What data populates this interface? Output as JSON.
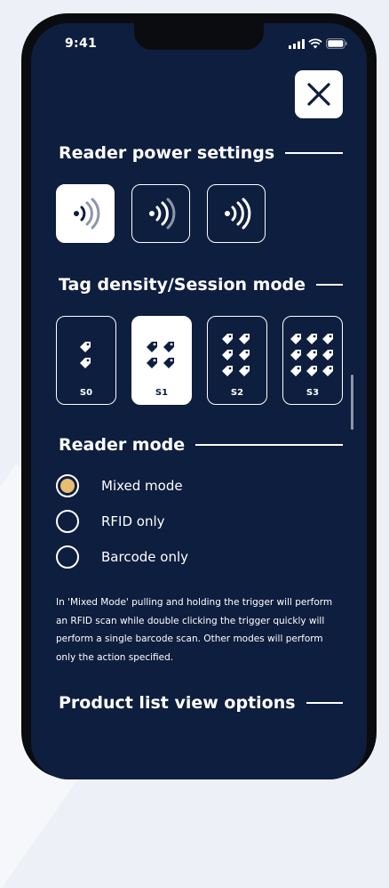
{
  "status_bar": {
    "time": "9:41"
  },
  "colors": {
    "background": "#0e1e3e",
    "accent": "#e9bd6f",
    "text": "#ffffff",
    "wave_muted": "#8d97ab"
  },
  "sections": {
    "power_title": "Reader power settings",
    "density_title": "Tag density/Session mode",
    "mode_title": "Reader mode",
    "list_title": "Product list view options"
  },
  "power_levels": [
    {
      "icon": "signal-strength-low-icon",
      "selected": true
    },
    {
      "icon": "signal-strength-medium-icon",
      "selected": false
    },
    {
      "icon": "signal-strength-high-icon",
      "selected": false
    }
  ],
  "density_modes": [
    {
      "label": "S0",
      "icon": "tag-icon",
      "tag_count": 2,
      "selected": false
    },
    {
      "label": "S1",
      "icon": "tag-icon",
      "tag_count": 4,
      "selected": true
    },
    {
      "label": "S2",
      "icon": "tag-icon",
      "tag_count": 6,
      "selected": false
    },
    {
      "label": "S3",
      "icon": "tag-icon",
      "tag_count": 9,
      "selected": false
    }
  ],
  "reader_modes": [
    {
      "label": "Mixed mode",
      "checked": true
    },
    {
      "label": "RFID only",
      "checked": false
    },
    {
      "label": "Barcode only",
      "checked": false
    }
  ],
  "description": "In 'Mixed Mode' pulling and holding the trigger will perform an RFID scan while double clicking the trigger quickly will perform a single barcode scan. Other modes will perform only the action specified."
}
